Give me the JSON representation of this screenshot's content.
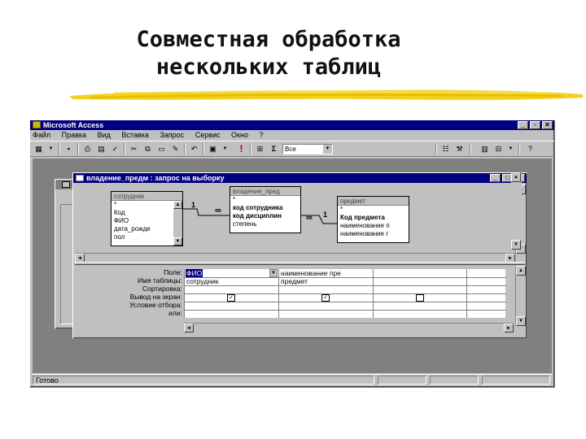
{
  "slide": {
    "title": "Совместная обработка\nнескольких таблиц"
  },
  "app": {
    "title": "Microsoft Access",
    "icon": "access-key-icon"
  },
  "menu": [
    "Файл",
    "Правка",
    "Вид",
    "Вставка",
    "Запрос",
    "Сервис",
    "Окно",
    "?"
  ],
  "toolbar": {
    "totals_sigma": "Σ",
    "run_glyph": "!",
    "top_values": "Все"
  },
  "query_window": {
    "title": "владение_предм : запрос на выборку"
  },
  "tables": [
    {
      "name": "сотрудник",
      "fields": [
        "*",
        "Код",
        "ФИО",
        "дата_рожде",
        "пол"
      ]
    },
    {
      "name": "владение_пред",
      "fields": [
        "*",
        "код сотрудника",
        "код дисциплин",
        "степень"
      ]
    },
    {
      "name": "предмет",
      "fields": [
        "*",
        "Код предмета",
        "наименование п",
        "наименование г"
      ]
    }
  ],
  "relations": {
    "one": "1",
    "many": "∞"
  },
  "grid": {
    "row_labels": [
      "Поле:",
      "Имя таблицы:",
      "Сортировка:",
      "Вывод на экран:",
      "Условие отбора:",
      "или:"
    ],
    "columns": [
      {
        "field": "ФИО",
        "table": "сотрудник",
        "show": true
      },
      {
        "field": "наименование пре",
        "table": "предмет",
        "show": true
      },
      {
        "field": "",
        "table": "",
        "show": false
      }
    ]
  },
  "status": {
    "text": "Готово"
  },
  "colors": {
    "title_bar": "#000080",
    "face": "#c0c0c0",
    "highlight_brush": "#f0d020"
  }
}
